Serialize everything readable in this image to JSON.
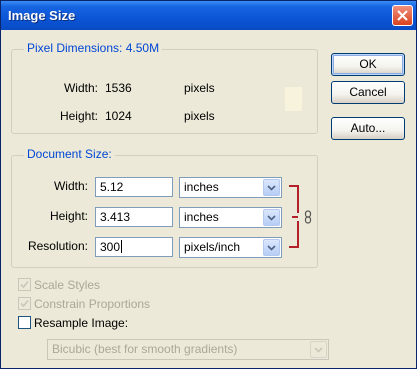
{
  "window": {
    "title": "Image Size"
  },
  "pixel_dimensions": {
    "legend": "Pixel Dimensions:",
    "size": "4.50M",
    "width_label": "Width:",
    "width_value": "1536",
    "width_unit": "pixels",
    "height_label": "Height:",
    "height_value": "1024",
    "height_unit": "pixels"
  },
  "document_size": {
    "legend": "Document Size:",
    "width_label": "Width:",
    "width_value": "5.12",
    "width_unit": "inches",
    "height_label": "Height:",
    "height_value": "3.413",
    "height_unit": "inches",
    "resolution_label": "Resolution:",
    "resolution_value": "300",
    "resolution_unit": "pixels/inch"
  },
  "buttons": {
    "ok": "OK",
    "cancel": "Cancel",
    "auto": "Auto..."
  },
  "options": {
    "scale_styles": {
      "label": "Scale Styles",
      "checked": true,
      "enabled": false
    },
    "constrain_proportions": {
      "label": "Constrain Proportions",
      "checked": true,
      "enabled": false
    },
    "resample_image": {
      "label": "Resample Image:",
      "checked": false,
      "enabled": true
    },
    "resample_method": "Bicubic (best for smooth gradients)"
  },
  "icons": {
    "close": "close-icon",
    "link": "chain-link-icon",
    "dropdown": "chevron-down-icon"
  },
  "colors": {
    "accent": "#0046d5",
    "titlebar": "#0b55d6",
    "bracket": "#b3202a"
  }
}
